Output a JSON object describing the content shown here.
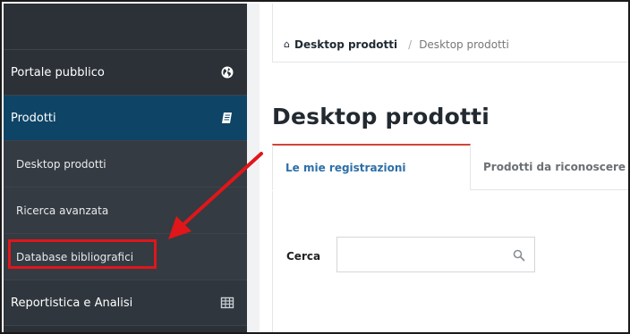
{
  "sidebar": {
    "items": [
      {
        "label": "Portale pubblico",
        "icon": "globe-icon"
      },
      {
        "label": "Prodotti",
        "icon": "book-icon"
      },
      {
        "label": "Desktop prodotti"
      },
      {
        "label": "Ricerca avanzata"
      },
      {
        "label": "Database bibliografici"
      },
      {
        "label": "Reportistica e Analisi",
        "icon": "table-icon"
      }
    ]
  },
  "breadcrumb": {
    "home": "Desktop prodotti",
    "separator": "/",
    "current": "Desktop prodotti"
  },
  "page": {
    "title": "Desktop prodotti"
  },
  "tabs": [
    {
      "label": "Le mie registrazioni",
      "active": true
    },
    {
      "label": "Prodotti da riconoscere",
      "active": false
    }
  ],
  "search": {
    "label": "Cerca",
    "value": "",
    "placeholder": ""
  },
  "colors": {
    "sidebar_bg": "#2b3137",
    "sidebar_active": "#0e4466",
    "annotation_red": "#e0161a",
    "tab_accent": "#cf4537",
    "link_blue": "#2d6fa8"
  }
}
